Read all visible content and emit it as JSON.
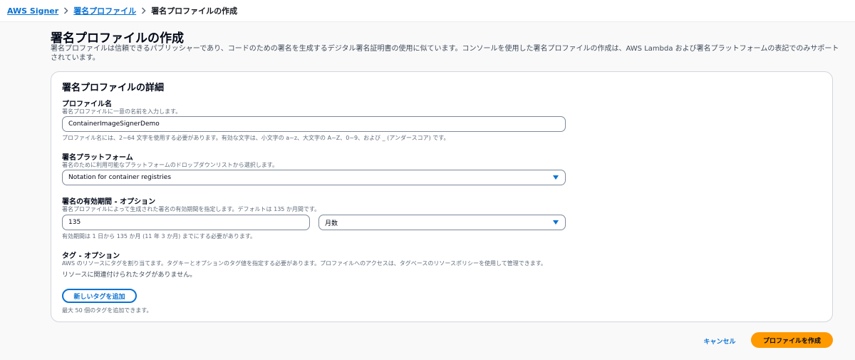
{
  "breadcrumb": {
    "items": [
      "AWS Signer",
      "署名プロファイル"
    ],
    "current": "署名プロファイルの作成"
  },
  "page": {
    "title": "署名プロファイルの作成",
    "description": "署名プロファイルは信頼できるパブリッシャーであり、コードのための署名を生成するデジタル署名証明書の使用に似ています。コンソールを使用した署名プロファイルの作成は、AWS Lambda および署名プラットフォームの表記でのみサポートされています。"
  },
  "card": {
    "title": "署名プロファイルの詳細"
  },
  "profile_name": {
    "label": "プロファイル名",
    "description": "署名プロファイルに一意の名前を入力します。",
    "value": "ContainerImageSignerDemo",
    "hint": "プロファイル名には、2~64 文字を使用する必要があります。有効な文字は、小文字の a~z、大文字の A~Z、0~9、および _ (アンダースコア) です。"
  },
  "platform": {
    "label": "署名プラットフォーム",
    "description": "署名のために利用可能なプラットフォームのドロップダウンリストから選択します。",
    "value": "Notation for container registries"
  },
  "validity": {
    "label": "署名の有効期間 - オプション",
    "description": "署名プロファイルによって生成された署名の有効期間を指定します。デフォルトは 135 か月間です。",
    "value": "135",
    "unit": "月数",
    "hint": "有効期間は 1 日から 135 か月 (11 年 3 か月) までにする必要があります。"
  },
  "tags": {
    "label": "タグ - オプション",
    "description": "AWS のリソースにタグを割り当てます。タグキーとオプションのタグ値を指定する必要があります。プロファイルへのアクセスは、タグベースのリソースポリシーを使用して管理できます。",
    "empty_text": "リソースに関連付けられたタグがありません。",
    "add_button": "新しいタグを追加",
    "limit_hint": "最大 50 個のタグを追加できます。"
  },
  "actions": {
    "cancel": "キャンセル",
    "create": "プロファイルを作成"
  },
  "colors": {
    "link": "#0972d3",
    "primary_button": "#ff9900"
  }
}
